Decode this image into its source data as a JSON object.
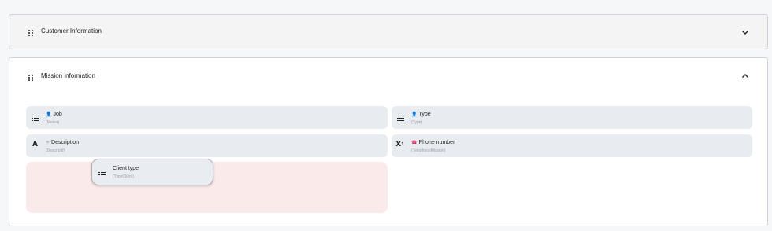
{
  "sections": {
    "customer": {
      "title": "Customer Information",
      "state": "collapsed",
      "toggle_icon": "chevron-down-icon"
    },
    "mission": {
      "title": "Mission information",
      "state": "expanded",
      "toggle_icon": "chevron-up-icon"
    }
  },
  "fields": {
    "job": {
      "label": "Job",
      "key": "(Metier)",
      "icon": "list-icon",
      "emoji": "👤"
    },
    "type": {
      "label": "Type",
      "key": "(Type)",
      "icon": "list-icon",
      "emoji": "👤"
    },
    "description": {
      "label": "Description",
      "key": "(Descriptif)",
      "icon": "text-format-icon",
      "emoji": "✳"
    },
    "phone": {
      "label": "Phone number",
      "key": "(TelephoneMission)",
      "icon": "superscript-icon",
      "emoji": "☎"
    }
  },
  "dragging": {
    "label": "Client type",
    "key": "(TypeClient)",
    "icon": "list-icon"
  },
  "colors": {
    "dropzone": "#fbeaea",
    "field_bg": "#e8ecf0",
    "phone_emoji": "#e0245e"
  }
}
